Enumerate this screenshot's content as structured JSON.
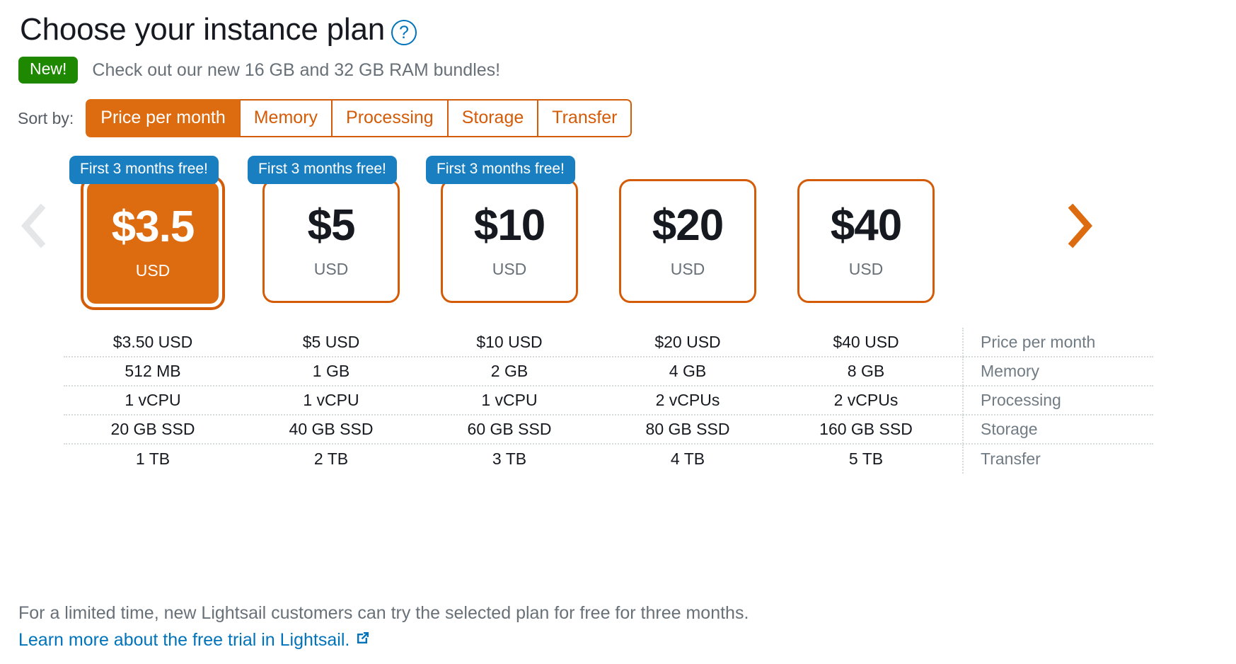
{
  "header": {
    "title": "Choose your instance plan",
    "help_icon": "question-circle-icon",
    "help_glyph": "?"
  },
  "promo": {
    "badge": "New!",
    "badge_color": "#1e8900",
    "text": "Check out our new 16 GB and 32 GB RAM bundles!"
  },
  "sort": {
    "label": "Sort by:",
    "active": "Price per month",
    "accent_color": "#dd6b10",
    "tabs": [
      {
        "label": "Price per month",
        "active": true
      },
      {
        "label": "Memory",
        "active": false
      },
      {
        "label": "Processing",
        "active": false
      },
      {
        "label": "Storage",
        "active": false
      },
      {
        "label": "Transfer",
        "active": false
      }
    ]
  },
  "carousel": {
    "prev_icon": "chevron-left-icon",
    "next_icon": "chevron-right-icon",
    "prev_enabled": false,
    "next_enabled": true,
    "prev_color": "#e4e6e7",
    "next_color": "#dd6b10"
  },
  "plans": [
    {
      "price": "$3.5",
      "currency": "USD",
      "badge": "First 3 months free!",
      "has_badge": true,
      "selected": true
    },
    {
      "price": "$5",
      "currency": "USD",
      "badge": "First 3 months free!",
      "has_badge": true,
      "selected": false
    },
    {
      "price": "$10",
      "currency": "USD",
      "badge": "First 3 months free!",
      "has_badge": true,
      "selected": false
    },
    {
      "price": "$20",
      "currency": "USD",
      "badge": "",
      "has_badge": false,
      "selected": false
    },
    {
      "price": "$40",
      "currency": "USD",
      "badge": "",
      "has_badge": false,
      "selected": false
    }
  ],
  "spec_table": {
    "row_labels": [
      "Price per month",
      "Memory",
      "Processing",
      "Storage",
      "Transfer"
    ],
    "rows": [
      {
        "label": "Price per month",
        "values": [
          "$3.50 USD",
          "$5 USD",
          "$10 USD",
          "$20 USD",
          "$40 USD"
        ]
      },
      {
        "label": "Memory",
        "values": [
          "512 MB",
          "1 GB",
          "2 GB",
          "4 GB",
          "8 GB"
        ]
      },
      {
        "label": "Processing",
        "values": [
          "1 vCPU",
          "1 vCPU",
          "1 vCPU",
          "2 vCPUs",
          "2 vCPUs"
        ]
      },
      {
        "label": "Storage",
        "values": [
          "20 GB SSD",
          "40 GB SSD",
          "60 GB SSD",
          "80 GB SSD",
          "160 GB SSD"
        ]
      },
      {
        "label": "Transfer",
        "values": [
          "1 TB",
          "2 TB",
          "3 TB",
          "4 TB",
          "5 TB"
        ]
      }
    ]
  },
  "footer": {
    "text": "For a limited time, new Lightsail customers can try the selected plan for free for three months.",
    "link_text": "Learn more about the free trial in Lightsail.",
    "link_icon": "external-link-icon",
    "link_color": "#0073bb"
  },
  "badge_colors": {
    "free_trial_badge": "#1a7fc1",
    "selected_card": "#dd6b10",
    "card_border": "#d45b07"
  }
}
